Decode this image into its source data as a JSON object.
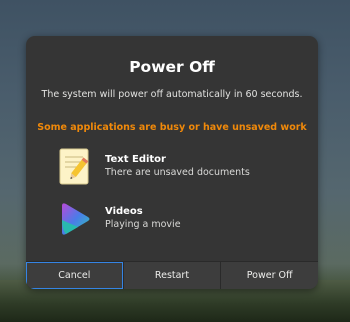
{
  "dialog": {
    "title": "Power Off",
    "message": "The system will power off automatically in 60 seconds.",
    "warning": "Some applications are busy or have unsaved work",
    "warning_color": "#f0890a",
    "apps": [
      {
        "name": "Text Editor",
        "status": "There are unsaved documents",
        "icon": "text-editor-icon"
      },
      {
        "name": "Videos",
        "status": "Playing a movie",
        "icon": "videos-icon"
      }
    ],
    "buttons": {
      "cancel": "Cancel",
      "restart": "Restart",
      "power_off": "Power Off"
    },
    "focus_color": "#3584e4"
  }
}
